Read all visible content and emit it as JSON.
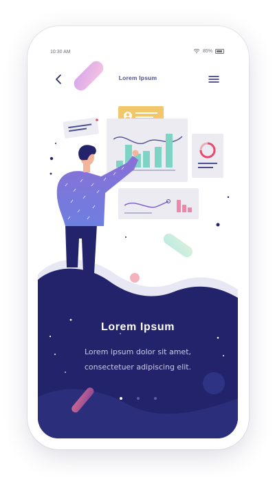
{
  "status_bar": {
    "time": "10:30 AM",
    "battery_percent": "85%"
  },
  "nav": {
    "title": "Lorem Ipsum",
    "back_icon": "chevron-left-icon",
    "menu_icon": "hamburger-menu-icon"
  },
  "hero": {
    "title": "Lorem Ipsum",
    "body_line1": "Lorem ipsum dolor sit amet,",
    "body_line2": "consectetuer adipiscing elit."
  },
  "pager": {
    "total": 3,
    "active_index": 0
  },
  "colors": {
    "navy": "#23236b",
    "accent_purple": "#4b4e8e",
    "chart_teal": "#7fd3c4",
    "chart_pink": "#ea8aa8",
    "callout_yellow": "#f2c66b"
  }
}
